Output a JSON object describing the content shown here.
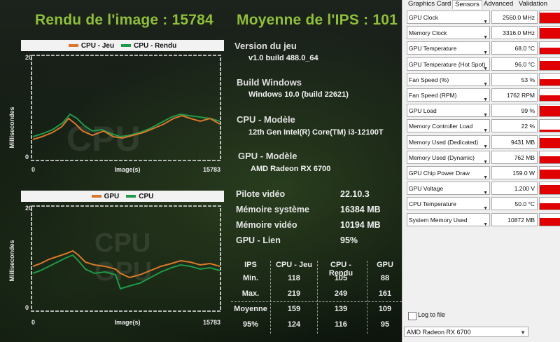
{
  "bench": {
    "frame_render_label": "Rendu de l'image : 15784",
    "avg_fps_label": "Moyenne de l'IPS : 101",
    "chart1": {
      "legend": [
        "CPU - Jeu",
        "CPU - Rendu"
      ],
      "watermark": "CPU",
      "ylabel": "Millisecondes",
      "xlabel": "Image(s)",
      "y_max": "20",
      "y_min": "0",
      "x_min": "0",
      "x_max": "15783"
    },
    "chart2": {
      "legend": [
        "GPU",
        "CPU"
      ],
      "watermark1": "CPU",
      "watermark2": "GPU",
      "ylabel": "Millisecondes",
      "xlabel": "Image(s)",
      "y_max": "20",
      "y_min": "0",
      "x_min": "0",
      "x_max": "15783"
    },
    "info": {
      "game_version_label": "Version du jeu",
      "game_version": "v1.0 build 488.0_64",
      "build_label": "Build Windows",
      "build": "Windows 10.0 (build 22621)",
      "cpu_model_label": "CPU - Modèle",
      "cpu_model": "12th Gen Intel(R) Core(TM) i3-12100T",
      "gpu_model_label": "GPU - Modèle",
      "gpu_model": "AMD Radeon RX 6700"
    },
    "specs": [
      {
        "label": "Pilote vidéo",
        "value": "22.10.3"
      },
      {
        "label": "Mémoire système",
        "value": "16384 MB"
      },
      {
        "label": "Mémoire vidéo",
        "value": "10194 MB"
      },
      {
        "label": "GPU - Lien",
        "value": "95%"
      }
    ],
    "fps_table": {
      "headers": [
        "IPS",
        "CPU - Jeu",
        "CPU - Rendu",
        "GPU"
      ],
      "rows": [
        [
          "Min.",
          "118",
          "105",
          "88"
        ],
        [
          "Max.",
          "219",
          "249",
          "161"
        ],
        [
          "Moyenne",
          "159",
          "139",
          "109"
        ],
        [
          "95%",
          "124",
          "116",
          "95"
        ]
      ]
    }
  },
  "gpuz": {
    "tabs": [
      "Graphics Card",
      "Sensors",
      "Advanced",
      "Validation"
    ],
    "active_tab": "Sensors",
    "sensors": [
      {
        "name": "GPU Clock",
        "value": "2560.0 MHz",
        "level": 0.9
      },
      {
        "name": "Memory Clock",
        "value": "3316.0 MHz",
        "level": 0.9
      },
      {
        "name": "GPU Temperature",
        "value": "68.0 °C",
        "level": 0.55
      },
      {
        "name": "GPU Temperature (Hot Spot)",
        "value": "96.0 °C",
        "level": 0.75
      },
      {
        "name": "Fan Speed (%)",
        "value": "53 %",
        "level": 0.5
      },
      {
        "name": "Fan Speed (RPM)",
        "value": "1762 RPM",
        "level": 0.5
      },
      {
        "name": "GPU Load",
        "value": "99 %",
        "level": 0.9
      },
      {
        "name": "Memory Controller Load",
        "value": "22 %",
        "level": 0.2
      },
      {
        "name": "Memory Used (Dedicated)",
        "value": "9431 MB",
        "level": 0.8
      },
      {
        "name": "Memory Used (Dynamic)",
        "value": "762 MB",
        "level": 0.6
      },
      {
        "name": "GPU Chip Power Draw",
        "value": "159.0 W",
        "level": 0.75
      },
      {
        "name": "GPU Voltage",
        "value": "1.200 V",
        "level": 0.8
      },
      {
        "name": "CPU Temperature",
        "value": "50.0 °C",
        "level": 0.55
      },
      {
        "name": "System Memory Used",
        "value": "10872 MB",
        "level": 0.6
      }
    ],
    "log_to_file": "Log to file",
    "device": "AMD Radeon RX 6700"
  },
  "colors": {
    "header_green": "#8fbf3a",
    "series_orange": "#d9782a",
    "series_green": "#1e9a4a",
    "gpuz_graph_red": "#e00000"
  }
}
